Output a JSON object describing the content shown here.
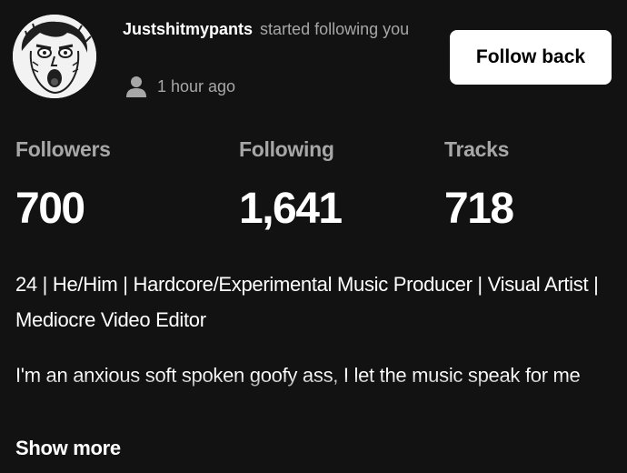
{
  "notification": {
    "username": "Justshitmypants",
    "action": "started following you",
    "time": "1 hour ago",
    "follow_back_label": "Follow back"
  },
  "stats": [
    {
      "label": "Followers",
      "value": "700"
    },
    {
      "label": "Following",
      "value": "1,641"
    },
    {
      "label": "Tracks",
      "value": "718"
    }
  ],
  "profile": {
    "bio": "24 | He/Him | Hardcore/Experimental Music Producer | Visual Artist | Mediocre Video Editor",
    "description": "I'm an anxious soft spoken goofy ass, I let the music speak for me",
    "show_more_label": "Show more"
  },
  "colors": {
    "background": "#121212",
    "primary_text": "#ffffff",
    "secondary_text": "#a7a7a7",
    "button_bg": "#ffffff",
    "button_text": "#000000"
  },
  "icons": {
    "avatar": "screaming-face-avatar",
    "time": "person-icon"
  }
}
